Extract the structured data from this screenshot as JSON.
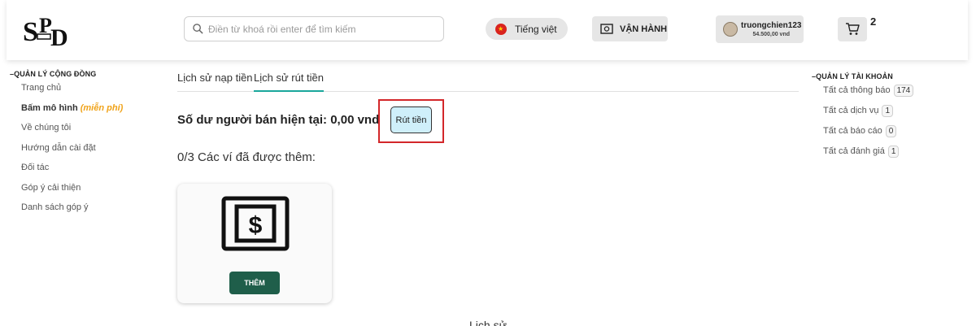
{
  "header": {
    "search_placeholder": "Điền từ khoá rồi enter để tìm kiếm",
    "language_label": "Tiếng việt",
    "operations_label": "VẬN HÀNH",
    "user": {
      "name": "truongchien123",
      "balance": "54.500,00 vnd"
    },
    "cart_count": "2"
  },
  "left_nav": {
    "title": "QUẢN LÝ CỘNG ĐỒNG",
    "items": [
      "Trang chủ",
      "Về chúng tôi",
      "Hướng dẫn cài đặt",
      "Đối tác",
      "Góp ý cải thiện",
      "Danh sách góp ý"
    ],
    "model_item": {
      "label": "Bấm mô hình",
      "free_tag": "(miễn phí)"
    }
  },
  "tabs": [
    {
      "label": "Lịch sử nạp tiền",
      "active": false
    },
    {
      "label": "Lịch sử rút tiền",
      "active": true
    }
  ],
  "main": {
    "balance_text": "Số dư người bán hiện tại: 0,00 vnd",
    "withdraw_label": "Rút tiền",
    "wallets_title": "0/3 Các ví đã được thêm:",
    "add_label": "THÊM",
    "history_title": "Lịch sử"
  },
  "right_nav": {
    "title": "QUẢN LÝ TÀI KHOẢN",
    "items": [
      {
        "label": "Tất cả thông báo",
        "count": "174"
      },
      {
        "label": "Tất cả dịch vụ",
        "count": "1"
      },
      {
        "label": "Tất cả báo cáo",
        "count": "0"
      },
      {
        "label": "Tất cả đánh giá",
        "count": "1"
      }
    ]
  },
  "colors": {
    "accent_teal": "#1aa79c",
    "add_button": "#1f5e4a",
    "highlight_red": "#d3272a",
    "withdraw_bg": "#cfeffa",
    "free_tag": "#f0a31a"
  },
  "icons": {
    "logo": "sbd-logo",
    "search": "search-icon",
    "flag": "vietnam-flag-icon",
    "operations": "cash-icon",
    "cart": "cart-icon",
    "wallet": "dollar-bill-icon"
  }
}
